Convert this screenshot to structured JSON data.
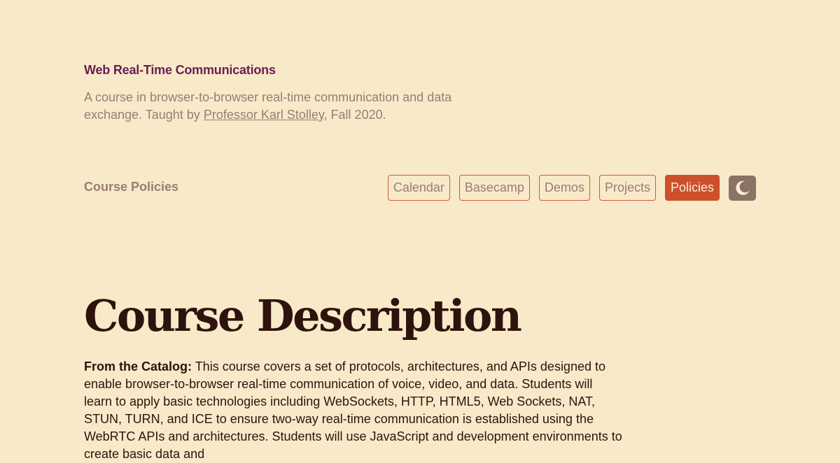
{
  "header": {
    "site_title": "Web Real-Time Communications",
    "tagline_before": "A course in browser-to-browser real-time communication and data exchange. Taught by ",
    "tagline_link": "Professor Karl Stolley",
    "tagline_after": ", Fall 2020."
  },
  "page": {
    "section_label": "Course Policies"
  },
  "nav": {
    "items": [
      {
        "label": "Calendar"
      },
      {
        "label": "Basecamp"
      },
      {
        "label": "Demos"
      },
      {
        "label": "Projects"
      },
      {
        "label": "Policies"
      }
    ],
    "active": "Policies",
    "theme_toggle_icon": "moon-icon"
  },
  "content": {
    "heading": "Course Description",
    "lead_label": "From the Catalog:",
    "paragraph": " This course covers a set of protocols, architectures, and APIs designed to enable browser-to-browser real-time communication of voice, video, and data. Students will learn to apply basic technologies including WebSockets, HTTP, HTML5, Web Sockets, NAT, STUN, TURN, and ICE to ensure two-way real-time communication is established using the WebRTC APIs and architectures. Students will use JavaScript and development environments to create basic data and"
  },
  "colors": {
    "background": "#f8e9c9",
    "site_title": "#6a1e52",
    "muted_text": "#9a7d74",
    "accent": "#cd4f2b",
    "heading": "#2e130d",
    "toggle": "#8a7364"
  }
}
